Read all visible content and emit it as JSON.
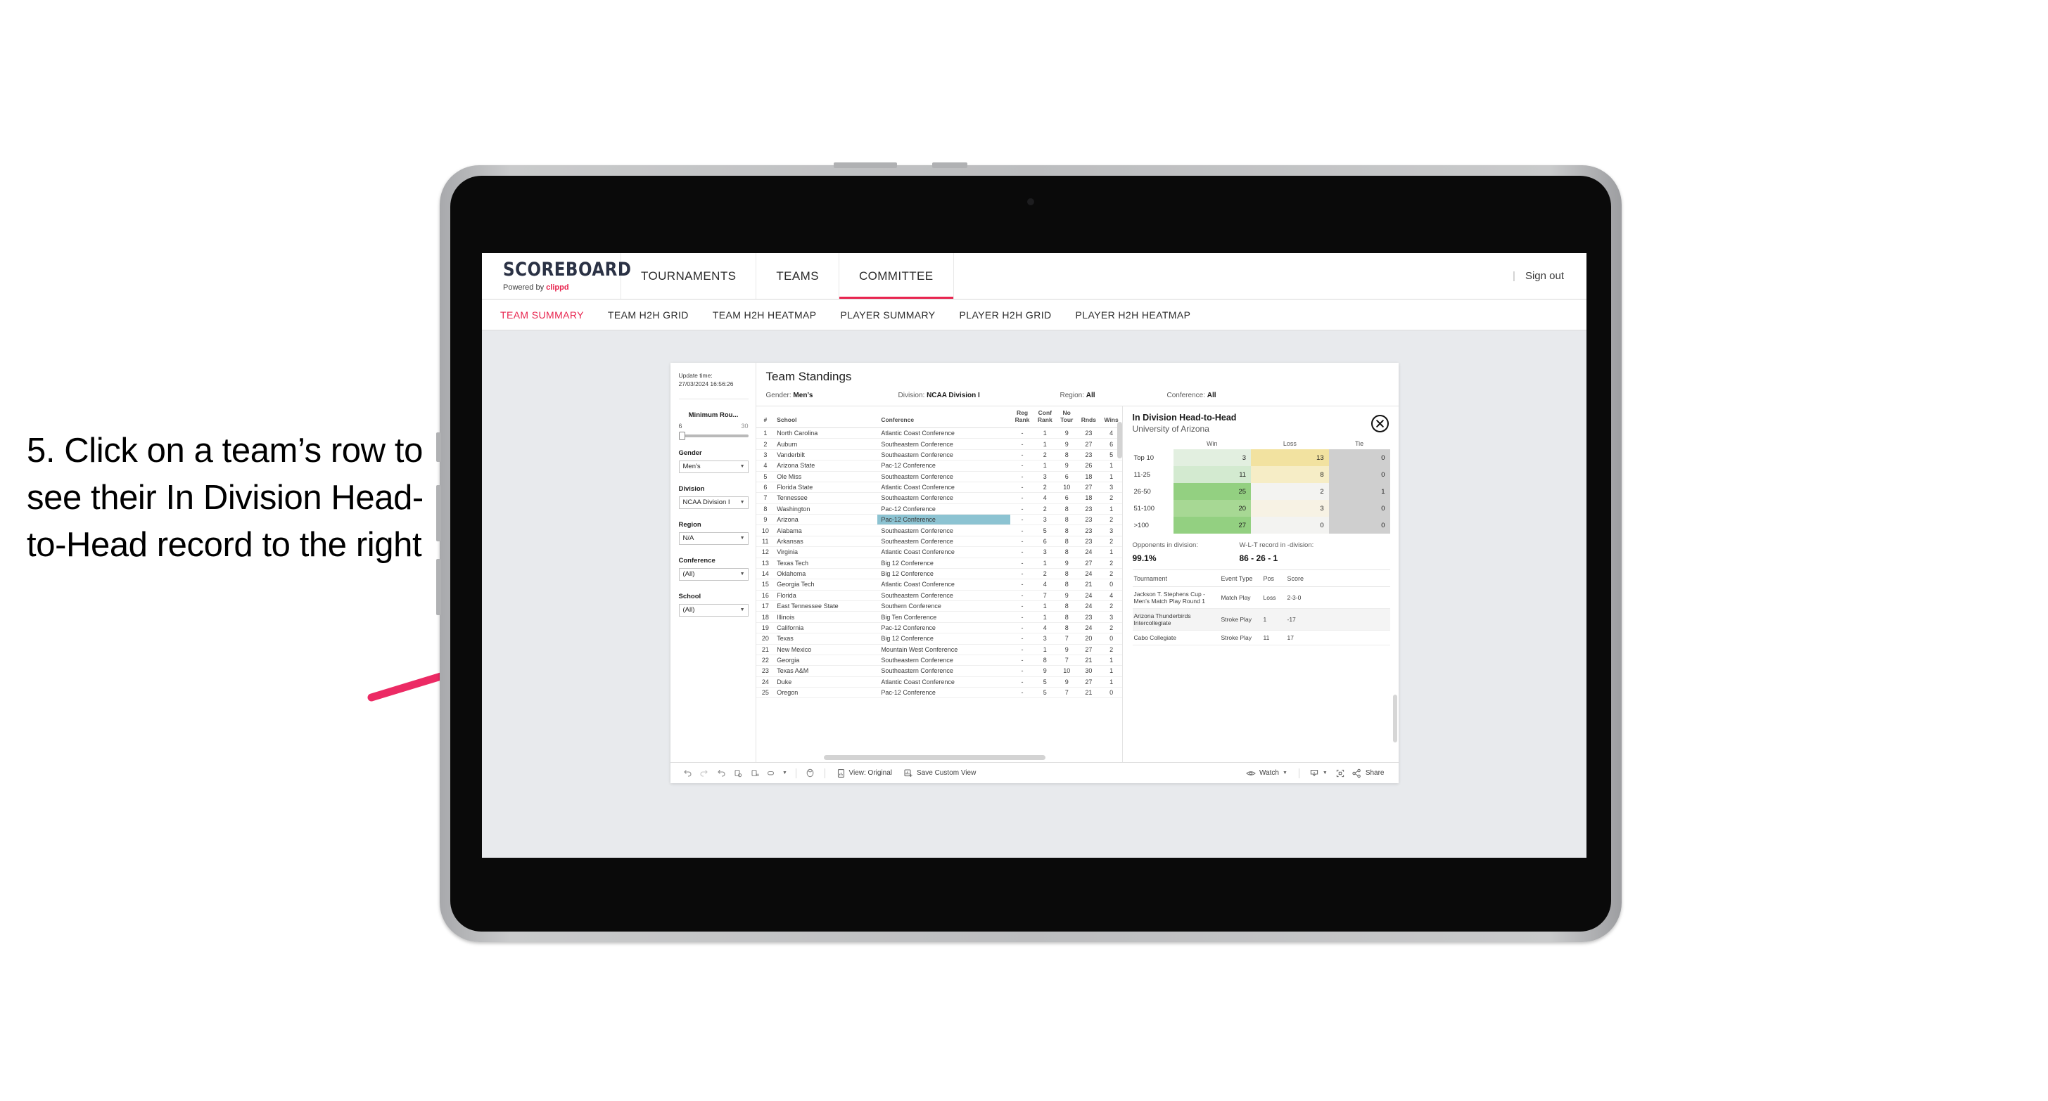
{
  "annotation": {
    "text": "5. Click on a team’s row to see their In Division Head-to-Head record to the right",
    "arrow_color": "#ec2a64"
  },
  "header": {
    "logo_title": "SCOREBOARD",
    "logo_powered": "Powered by",
    "logo_brand": "clippd",
    "nav": [
      {
        "label": "TOURNAMENTS",
        "active": false
      },
      {
        "label": "TEAMS",
        "active": false
      },
      {
        "label": "COMMITTEE",
        "active": true
      }
    ],
    "divider": "|",
    "sign_out": "Sign out",
    "accent_color": "#e8254f"
  },
  "subtabs": [
    {
      "label": "TEAM SUMMARY",
      "active": true
    },
    {
      "label": "TEAM H2H GRID",
      "active": false
    },
    {
      "label": "TEAM H2H HEATMAP",
      "active": false
    },
    {
      "label": "PLAYER SUMMARY",
      "active": false
    },
    {
      "label": "PLAYER H2H GRID",
      "active": false
    },
    {
      "label": "PLAYER H2H HEATMAP",
      "active": false
    }
  ],
  "filters": {
    "update_label": "Update time:",
    "update_value": "27/03/2024 16:56:26",
    "slider": {
      "title": "Minimum Rou...",
      "min": "6",
      "max": "30"
    },
    "groups": [
      {
        "title": "Gender",
        "value": "Men’s"
      },
      {
        "title": "Division",
        "value": "NCAA Division I"
      },
      {
        "title": "Region",
        "value": "N/A"
      },
      {
        "title": "Conference",
        "value": "(All)"
      },
      {
        "title": "School",
        "value": "(All)"
      }
    ]
  },
  "standings": {
    "title": "Team Standings",
    "meta": [
      {
        "label": "Gender:",
        "value": "Men’s"
      },
      {
        "label": "Division:",
        "value": "NCAA Division I"
      },
      {
        "label": "Region:",
        "value": "All"
      },
      {
        "label": "Conference:",
        "value": "All"
      }
    ],
    "columns": [
      "#",
      "School",
      "Conference",
      "Reg Rank",
      "Conf Rank",
      "No Tour",
      "Rnds",
      "Wins"
    ],
    "highlight_color": "#8cc3d2",
    "highlighted_row": 9,
    "rows": [
      {
        "rank": "1",
        "school": "North Carolina",
        "conference": "Atlantic Coast Conference",
        "reg": "-",
        "conf": "1",
        "notour": "9",
        "rnds": "23",
        "wins": "4"
      },
      {
        "rank": "2",
        "school": "Auburn",
        "conference": "Southeastern Conference",
        "reg": "-",
        "conf": "1",
        "notour": "9",
        "rnds": "27",
        "wins": "6"
      },
      {
        "rank": "3",
        "school": "Vanderbilt",
        "conference": "Southeastern Conference",
        "reg": "-",
        "conf": "2",
        "notour": "8",
        "rnds": "23",
        "wins": "5"
      },
      {
        "rank": "4",
        "school": "Arizona State",
        "conference": "Pac-12 Conference",
        "reg": "-",
        "conf": "1",
        "notour": "9",
        "rnds": "26",
        "wins": "1"
      },
      {
        "rank": "5",
        "school": "Ole Miss",
        "conference": "Southeastern Conference",
        "reg": "-",
        "conf": "3",
        "notour": "6",
        "rnds": "18",
        "wins": "1"
      },
      {
        "rank": "6",
        "school": "Florida State",
        "conference": "Atlantic Coast Conference",
        "reg": "-",
        "conf": "2",
        "notour": "10",
        "rnds": "27",
        "wins": "3"
      },
      {
        "rank": "7",
        "school": "Tennessee",
        "conference": "Southeastern Conference",
        "reg": "-",
        "conf": "4",
        "notour": "6",
        "rnds": "18",
        "wins": "2"
      },
      {
        "rank": "8",
        "school": "Washington",
        "conference": "Pac-12 Conference",
        "reg": "-",
        "conf": "2",
        "notour": "8",
        "rnds": "23",
        "wins": "1"
      },
      {
        "rank": "9",
        "school": "Arizona",
        "conference": "Pac-12 Conference",
        "reg": "-",
        "conf": "3",
        "notour": "8",
        "rnds": "23",
        "wins": "2"
      },
      {
        "rank": "10",
        "school": "Alabama",
        "conference": "Southeastern Conference",
        "reg": "-",
        "conf": "5",
        "notour": "8",
        "rnds": "23",
        "wins": "3"
      },
      {
        "rank": "11",
        "school": "Arkansas",
        "conference": "Southeastern Conference",
        "reg": "-",
        "conf": "6",
        "notour": "8",
        "rnds": "23",
        "wins": "2"
      },
      {
        "rank": "12",
        "school": "Virginia",
        "conference": "Atlantic Coast Conference",
        "reg": "-",
        "conf": "3",
        "notour": "8",
        "rnds": "24",
        "wins": "1"
      },
      {
        "rank": "13",
        "school": "Texas Tech",
        "conference": "Big 12 Conference",
        "reg": "-",
        "conf": "1",
        "notour": "9",
        "rnds": "27",
        "wins": "2"
      },
      {
        "rank": "14",
        "school": "Oklahoma",
        "conference": "Big 12 Conference",
        "reg": "-",
        "conf": "2",
        "notour": "8",
        "rnds": "24",
        "wins": "2"
      },
      {
        "rank": "15",
        "school": "Georgia Tech",
        "conference": "Atlantic Coast Conference",
        "reg": "-",
        "conf": "4",
        "notour": "8",
        "rnds": "21",
        "wins": "0"
      },
      {
        "rank": "16",
        "school": "Florida",
        "conference": "Southeastern Conference",
        "reg": "-",
        "conf": "7",
        "notour": "9",
        "rnds": "24",
        "wins": "4"
      },
      {
        "rank": "17",
        "school": "East Tennessee State",
        "conference": "Southern Conference",
        "reg": "-",
        "conf": "1",
        "notour": "8",
        "rnds": "24",
        "wins": "2"
      },
      {
        "rank": "18",
        "school": "Illinois",
        "conference": "Big Ten Conference",
        "reg": "-",
        "conf": "1",
        "notour": "8",
        "rnds": "23",
        "wins": "3"
      },
      {
        "rank": "19",
        "school": "California",
        "conference": "Pac-12 Conference",
        "reg": "-",
        "conf": "4",
        "notour": "8",
        "rnds": "24",
        "wins": "2"
      },
      {
        "rank": "20",
        "school": "Texas",
        "conference": "Big 12 Conference",
        "reg": "-",
        "conf": "3",
        "notour": "7",
        "rnds": "20",
        "wins": "0"
      },
      {
        "rank": "21",
        "school": "New Mexico",
        "conference": "Mountain West Conference",
        "reg": "-",
        "conf": "1",
        "notour": "9",
        "rnds": "27",
        "wins": "2"
      },
      {
        "rank": "22",
        "school": "Georgia",
        "conference": "Southeastern Conference",
        "reg": "-",
        "conf": "8",
        "notour": "7",
        "rnds": "21",
        "wins": "1"
      },
      {
        "rank": "23",
        "school": "Texas A&M",
        "conference": "Southeastern Conference",
        "reg": "-",
        "conf": "9",
        "notour": "10",
        "rnds": "30",
        "wins": "1"
      },
      {
        "rank": "24",
        "school": "Duke",
        "conference": "Atlantic Coast Conference",
        "reg": "-",
        "conf": "5",
        "notour": "9",
        "rnds": "27",
        "wins": "1"
      },
      {
        "rank": "25",
        "school": "Oregon",
        "conference": "Pac-12 Conference",
        "reg": "-",
        "conf": "5",
        "notour": "7",
        "rnds": "21",
        "wins": "0"
      }
    ]
  },
  "h2h": {
    "title": "In Division Head-to-Head",
    "subtitle": "University of Arizona",
    "close_icon": "close-icon",
    "columns": [
      "",
      "Win",
      "Loss",
      "Tie"
    ],
    "rows": [
      {
        "label": "Top 10",
        "win": "3",
        "loss": "13",
        "tie": "0",
        "win_color": "#e2efe0",
        "loss_color": "#f2e2a0",
        "tie_color": "#cfcfcf"
      },
      {
        "label": "11-25",
        "win": "11",
        "loss": "8",
        "tie": "0",
        "win_color": "#d3ead0",
        "loss_color": "#f6edc6",
        "tie_color": "#cfcfcf"
      },
      {
        "label": "26-50",
        "win": "25",
        "loss": "2",
        "tie": "1",
        "win_color": "#93d081",
        "loss_color": "#f3f3f1",
        "tie_color": "#cfcfcf"
      },
      {
        "label": "51-100",
        "win": "20",
        "loss": "3",
        "tie": "0",
        "win_color": "#a7d894",
        "loss_color": "#f7f2e4",
        "tie_color": "#cfcfcf"
      },
      {
        "label": ">100",
        "win": "27",
        "loss": "0",
        "tie": "0",
        "win_color": "#93d081",
        "loss_color": "#f3f3f1",
        "tie_color": "#cfcfcf"
      }
    ],
    "stats": [
      {
        "label": "Opponents in division:",
        "value": "99.1%"
      },
      {
        "label": "W-L-T record in -division:",
        "value": "86 - 26 - 1"
      }
    ],
    "tournament_columns": [
      "Tournament",
      "Event Type",
      "Pos",
      "Score"
    ],
    "tournaments": [
      {
        "name": "Jackson T. Stephens Cup - Men’s Match Play Round 1",
        "event_type": "Match Play",
        "pos": "Loss",
        "score": "2-3-0"
      },
      {
        "name": "Arizona Thunderbirds Intercollegiate",
        "event_type": "Stroke Play",
        "pos": "1",
        "score": "-17"
      },
      {
        "name": "Cabo Collegiate",
        "event_type": "Stroke Play",
        "pos": "11",
        "score": "17"
      }
    ]
  },
  "toolbar": {
    "view_label": "View: Original",
    "save_label": "Save Custom View",
    "watch_label": "Watch",
    "share_label": "Share"
  }
}
